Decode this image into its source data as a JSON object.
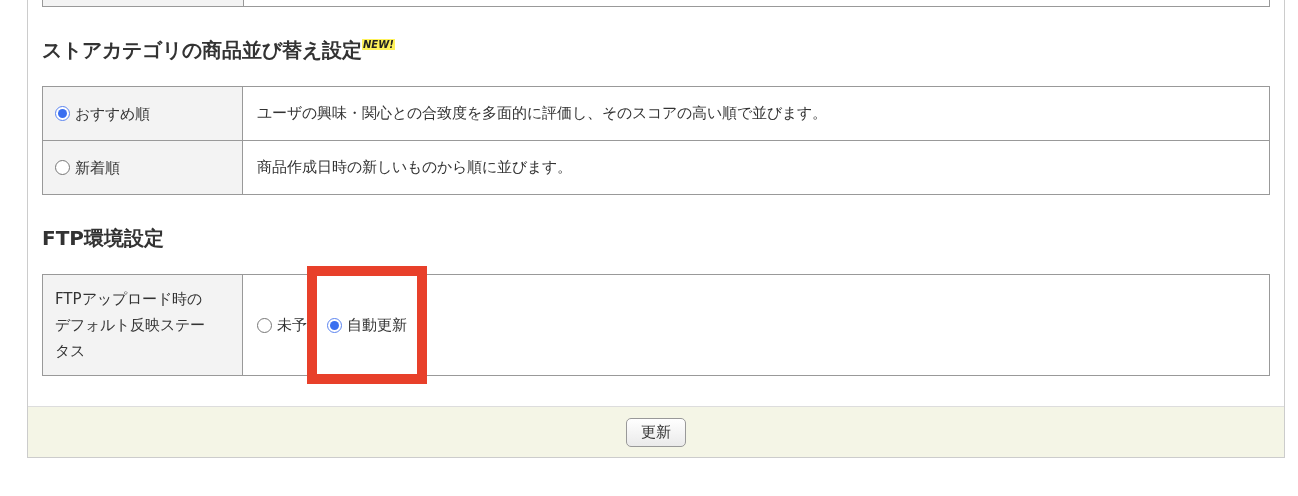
{
  "sections": [
    {
      "title": "ストアカテゴリの商品並び替え設定",
      "badge": "NEW!",
      "kind": "choice-table",
      "rows": [
        {
          "label": "おすすめ順",
          "selected": true,
          "description": "ユーザの興味・関心との合致度を多面的に評価し、そのスコアの高い順で並びます。"
        },
        {
          "label": "新着順",
          "selected": false,
          "description": "商品作成日時の新しいものから順に並びます。"
        }
      ]
    },
    {
      "title": "FTP環境設定",
      "kind": "field-table",
      "rows": [
        {
          "label": "FTPアップロード時のデフォルト反映ステータス",
          "options": [
            {
              "label": "未予",
              "selected": false,
              "highlighted": false
            },
            {
              "label": "自動更新",
              "selected": true,
              "highlighted": true
            }
          ]
        }
      ]
    }
  ],
  "footer": {
    "button": "更新"
  }
}
